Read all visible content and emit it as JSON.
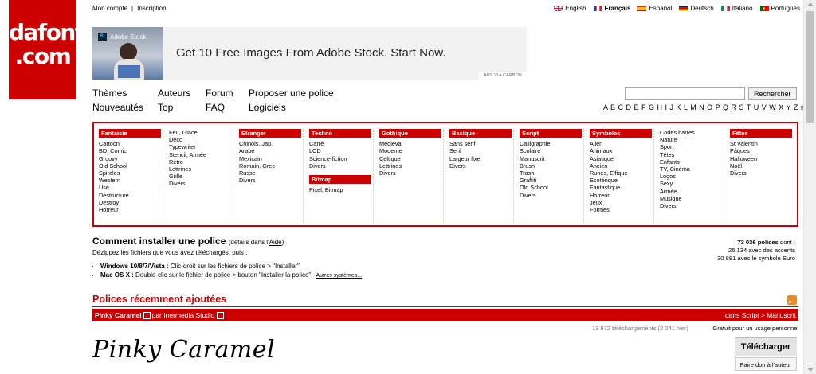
{
  "logo": {
    "line1": "dafont",
    "line2": ".com"
  },
  "topbar": {
    "account": "Mon compte",
    "separator": "|",
    "signup": "Inscription"
  },
  "languages": [
    {
      "label": "English",
      "active": false,
      "flag": "uk-flag-icon"
    },
    {
      "label": "Français",
      "active": true,
      "flag": "fr-flag-icon"
    },
    {
      "label": "Español",
      "active": false,
      "flag": "es-flag-icon"
    },
    {
      "label": "Deutsch",
      "active": false,
      "flag": "de-flag-icon"
    },
    {
      "label": "Italiano",
      "active": false,
      "flag": "it-flag-icon"
    },
    {
      "label": "Português",
      "active": false,
      "flag": "pt-flag-icon"
    }
  ],
  "ad": {
    "badge": "St",
    "brand": "Adobe Stock",
    "text": "Get 10 Free Images From Adobe Stock. Start Now.",
    "via": "ADS VIA CARBON"
  },
  "nav": {
    "themes": "Thèmes",
    "authors": "Auteurs",
    "forum": "Forum",
    "submit": "Proposer une police",
    "new": "Nouveautés",
    "top": "Top",
    "faq": "FAQ",
    "software": "Logiciels"
  },
  "search": {
    "value": "",
    "button": "Rechercher"
  },
  "alphabet": "A B C D E F G H I J K L M N O P Q R S T U V W X Y Z #",
  "categories": {
    "fantaisie": {
      "title": "Fantaisie",
      "items": [
        "Cartoon",
        "BD, Comic",
        "Groovy",
        "Old School",
        "Spirales",
        "Western",
        "Usé",
        "Destructuré",
        "Destroy",
        "Horreur"
      ]
    },
    "fantaisie2": {
      "items": [
        "Feu, Glace",
        "Déco",
        "Typewriter",
        "Stencil, Armée",
        "Rétro",
        "Lettrines",
        "Grille",
        "Divers"
      ]
    },
    "etranger": {
      "title": "Etranger",
      "items": [
        "Chinois, Jap.",
        "Arabe",
        "Mexicain",
        "Romain, Grec",
        "Russe",
        "Divers"
      ]
    },
    "techno": {
      "title": "Techno",
      "items": [
        "Carré",
        "LCD",
        "Science-fiction",
        "Divers"
      ]
    },
    "bitmap": {
      "title": "Bitmap",
      "items": [
        "Pixel, Bitmap"
      ]
    },
    "gothique": {
      "title": "Gothique",
      "items": [
        "Médiéval",
        "Moderne",
        "Celtique",
        "Lettrines",
        "Divers"
      ]
    },
    "basique": {
      "title": "Basique",
      "items": [
        "Sans serif",
        "Serif",
        "Largeur fixe",
        "Divers"
      ]
    },
    "script": {
      "title": "Script",
      "items": [
        "Calligraphie",
        "Scolaire",
        "Manuscrit",
        "Brush",
        "Trash",
        "Graffiti",
        "Old School",
        "Divers"
      ]
    },
    "symboles": {
      "title": "Symboles",
      "items": [
        "Alien",
        "Animaux",
        "Asiatique",
        "Ancien",
        "Runes, Elfique",
        "Esotérique",
        "Fantastique",
        "Horreur",
        "Jeux",
        "Formes"
      ]
    },
    "symboles2": {
      "items": [
        "Codes barres",
        "Nature",
        "Sport",
        "Têtes",
        "Enfants",
        "TV, Cinéma",
        "Logos",
        "Sexy",
        "Armée",
        "Musique",
        "Divers"
      ]
    },
    "fetes": {
      "title": "Fêtes",
      "items": [
        "St Valentin",
        "Pâques",
        "Halloween",
        "Noël",
        "Divers"
      ]
    }
  },
  "install": {
    "title": "Comment installer une police",
    "details_prefix": "(détails dans l'",
    "details_link": "Aide",
    "details_suffix": ")",
    "subtitle": "Dézippez les fichiers que vous avez téléchargés, puis :",
    "windows_label": "Windows 10/8/7/Vista :",
    "windows_text": "Clic-droit sur les fichiers de police > \"Installer\"",
    "mac_label": "Mac OS X :",
    "mac_text": "Double-clic sur le fichier de police > bouton \"Installer la police\".",
    "more": "Autres systèmes..."
  },
  "stats": {
    "total": "73 036 polices",
    "total_suffix": "dont :",
    "accents": "26 134 avec des accents",
    "euro": "30 881 avec le symbole Euro"
  },
  "recent": {
    "title": "Polices récemment ajoutées"
  },
  "font": {
    "name": "Pinky Caramel",
    "by": "par",
    "author": "Inermedia Studio",
    "category": "dans Script > Manuscrit",
    "downloads": "13 972 téléchargements (2 041 hier)",
    "licence": "Gratuit pour un usage personnel",
    "preview": "Pinky Caramel",
    "download_button": "Télécharger",
    "donate_button": "Faire don à l'auteur"
  }
}
